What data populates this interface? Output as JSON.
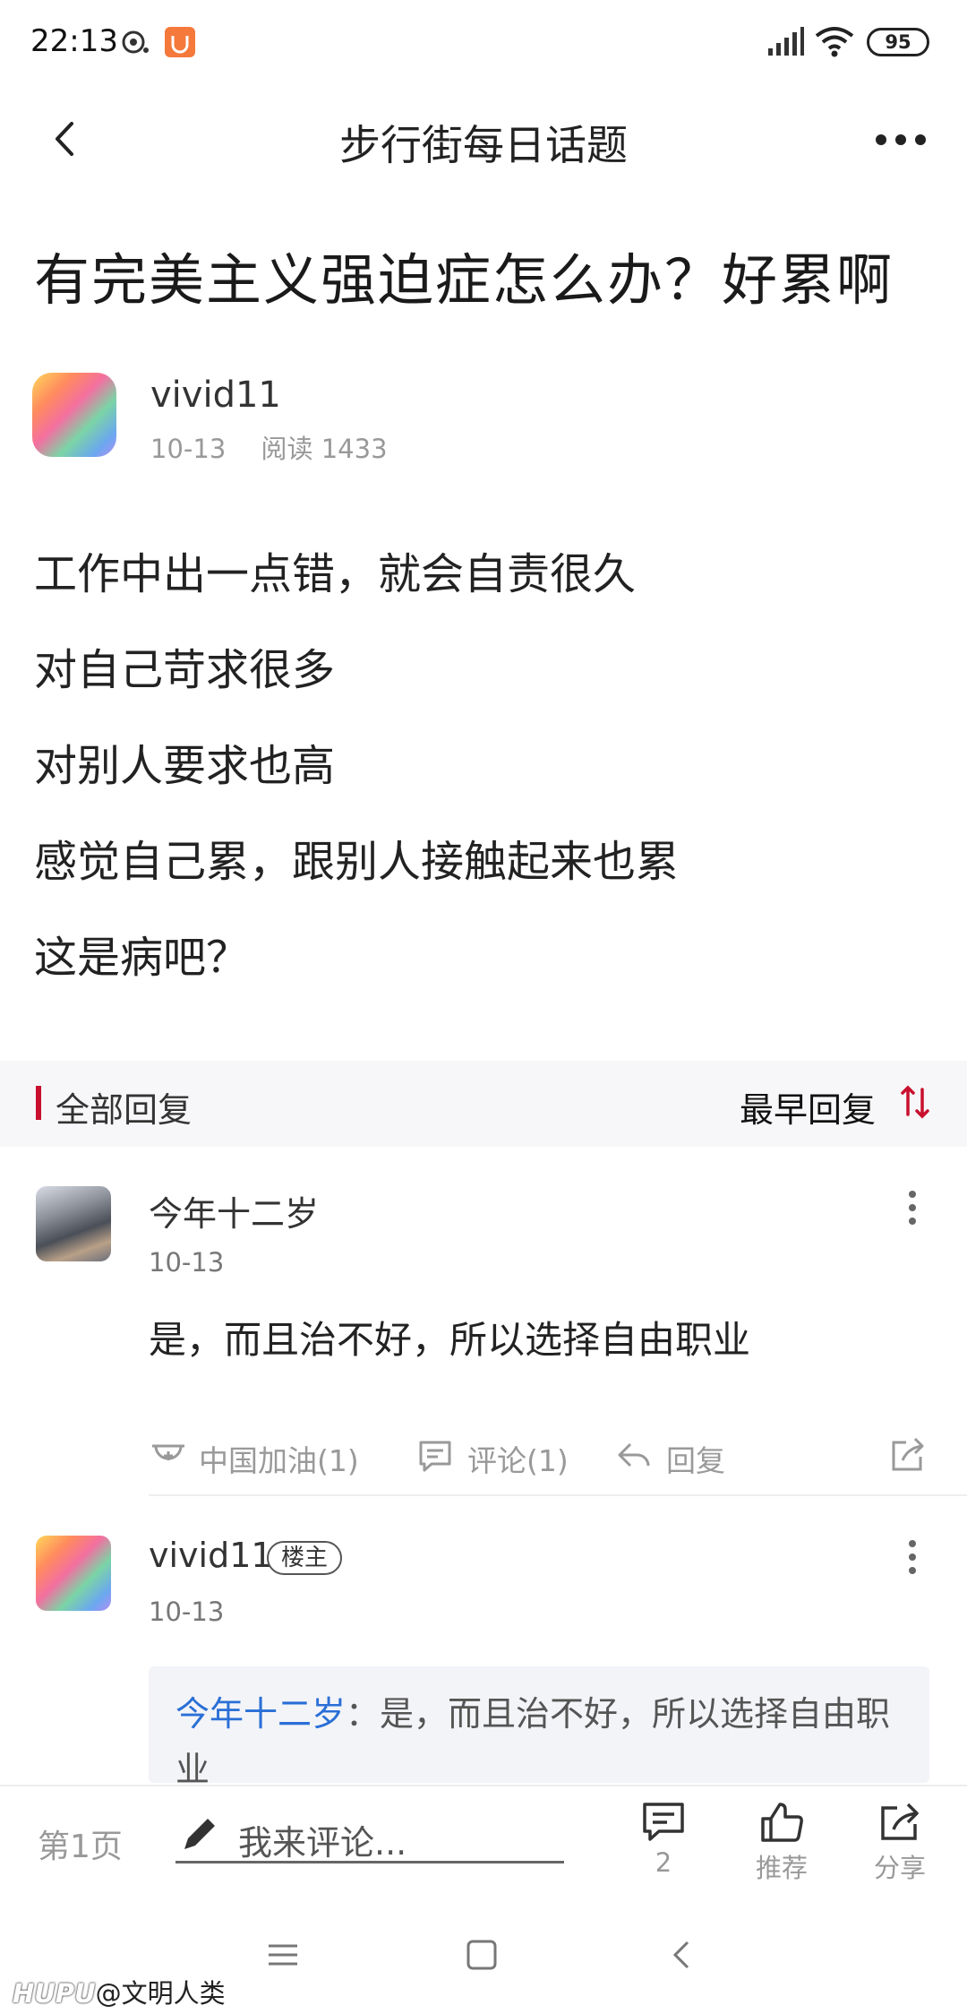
{
  "status_bar": {
    "time": "22:13",
    "battery": "95"
  },
  "nav": {
    "title": "步行街每日话题"
  },
  "post": {
    "title": "有完美主义强迫症怎么办？好累啊",
    "author": "vivid11",
    "date": "10-13",
    "reads": "阅读 1433",
    "lines": [
      "工作中出一点错，就会自责很久",
      "对自己苛求很多",
      "对别人要求也高",
      "感觉自己累，跟别人接触起来也累",
      "这是病吧？"
    ]
  },
  "replies_header": {
    "label": "全部回复",
    "sort_label": "最早回复",
    "accent": "#c8102e"
  },
  "replies": [
    {
      "author": "今年十二岁",
      "date": "10-13",
      "text": "是，而且治不好，所以选择自由职业",
      "actions": {
        "cheer": "中国加油(1)",
        "comment": "评论(1)",
        "reply": "回复"
      }
    },
    {
      "author": "vivid11",
      "badge": "楼主",
      "date": "10-13",
      "quote_author": "今年十二岁",
      "quote_text": "：是，而且治不好，所以选择自由职业"
    }
  ],
  "bottom_bar": {
    "page": "第1页",
    "placeholder": "我来评论...",
    "comment_count": "2",
    "recommend": "推荐",
    "share": "分享"
  },
  "watermark": {
    "brand": "HUPU",
    "user": "@文明人类"
  },
  "colors": {
    "link_blue": "#2a6fd6",
    "accent_red": "#c8102e"
  }
}
